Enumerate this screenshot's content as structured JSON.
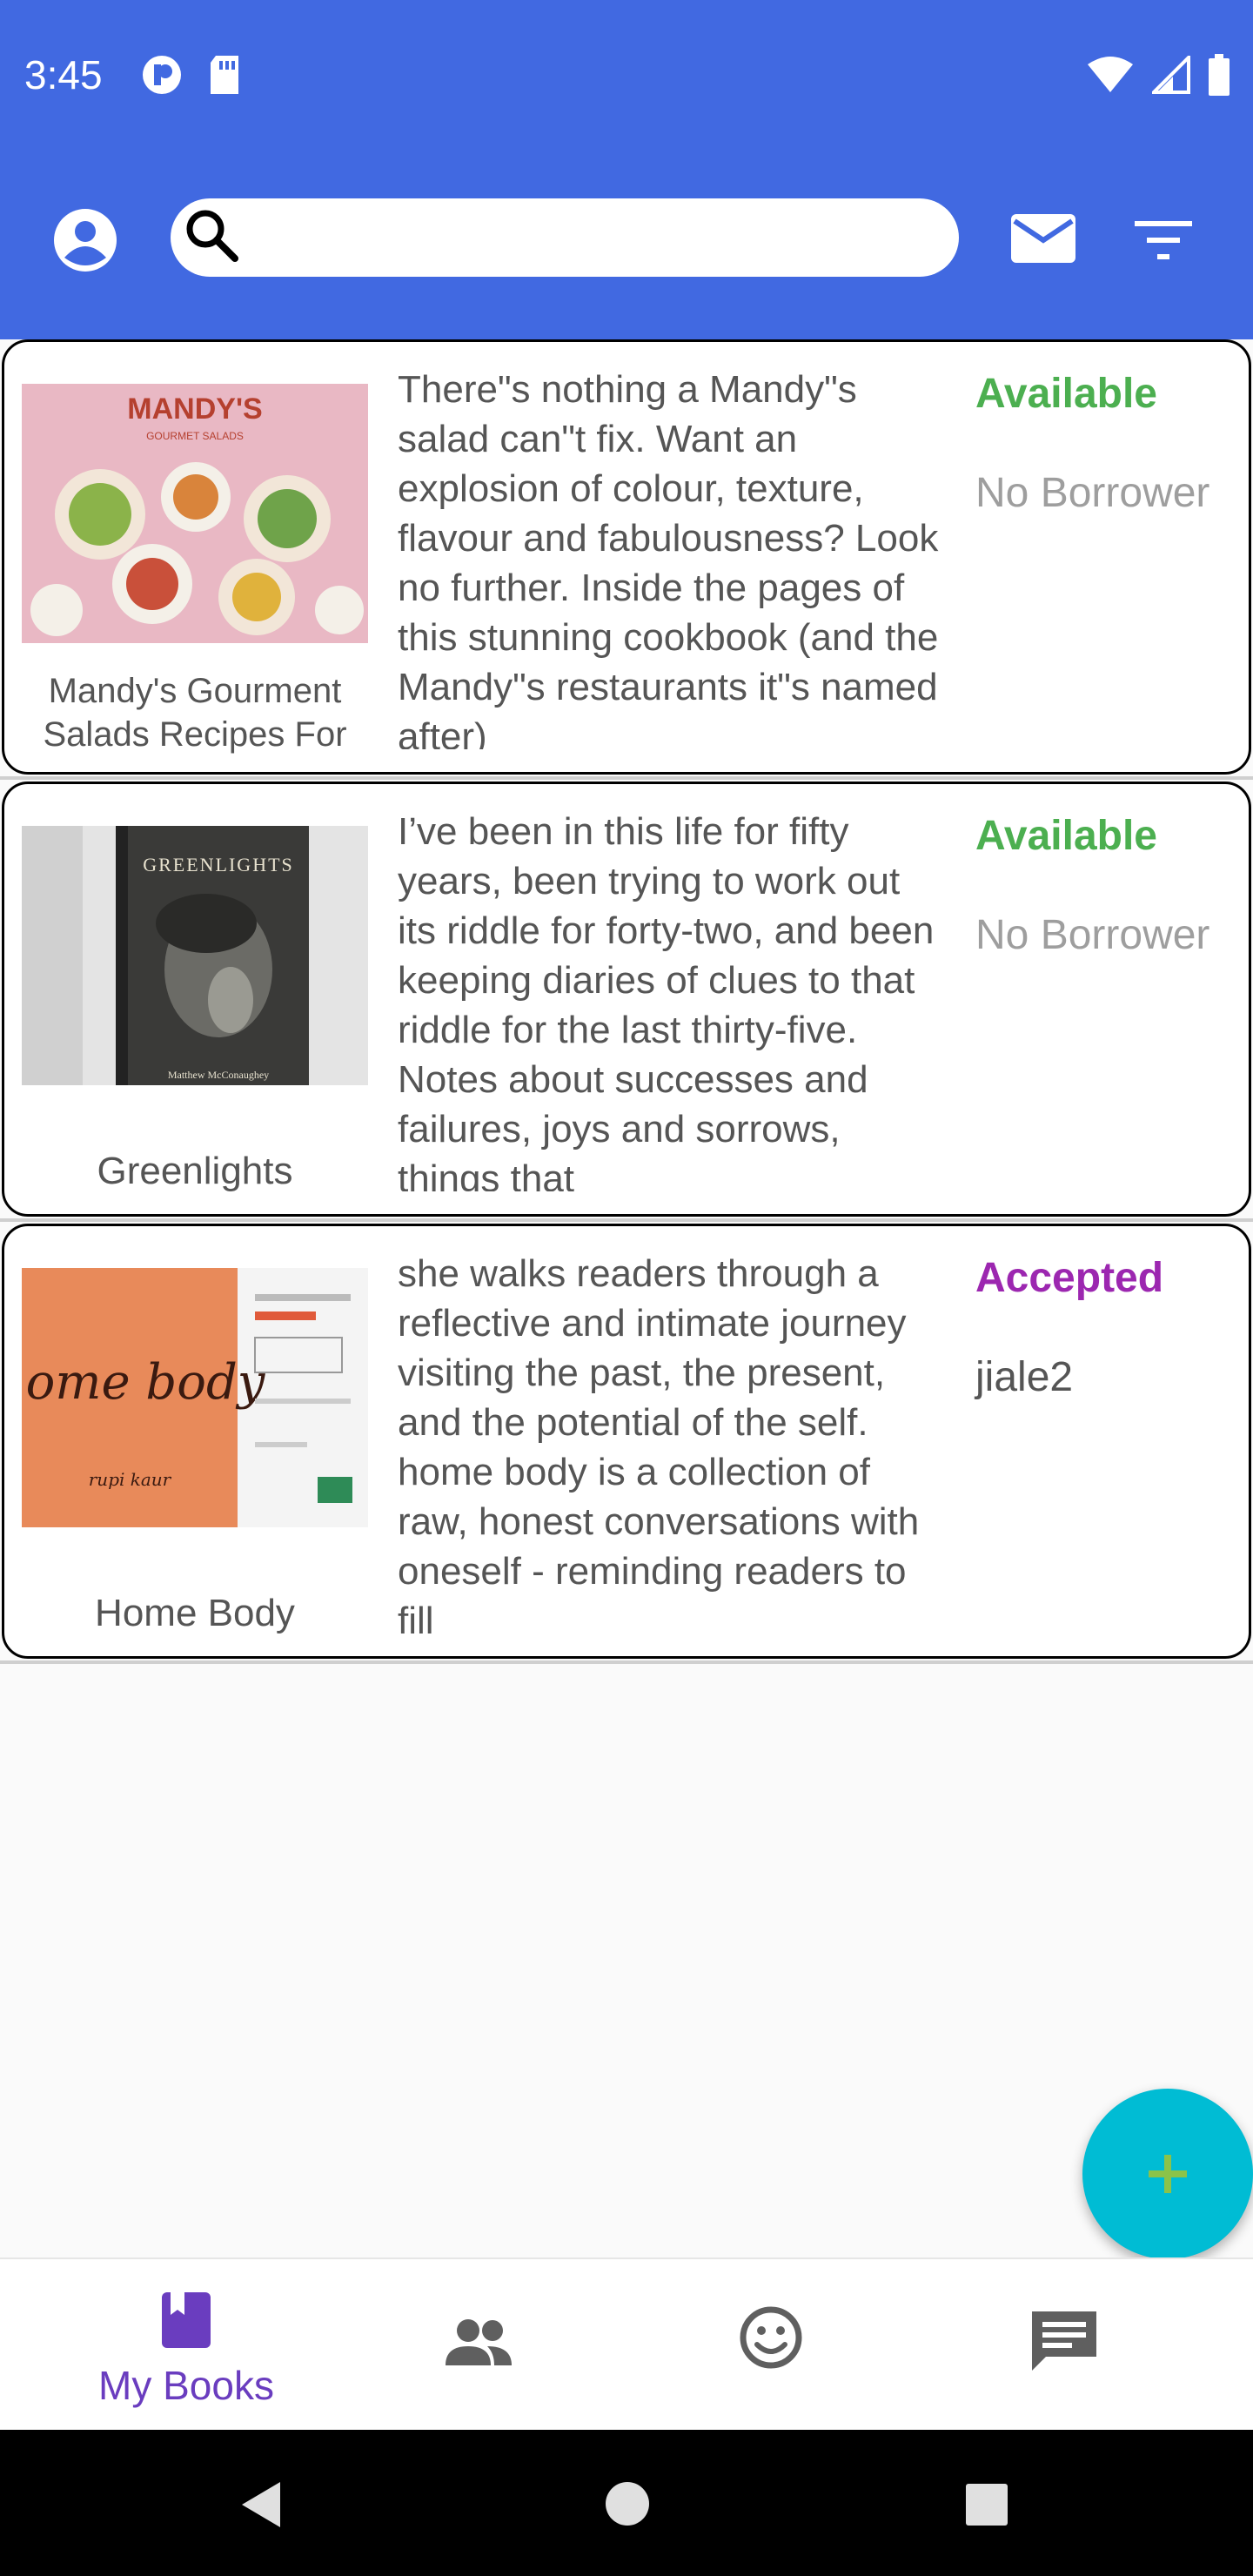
{
  "status_bar": {
    "time": "3:45",
    "icons": [
      "app-notification-icon",
      "sd-card-icon",
      "wifi-icon",
      "signal-icon",
      "battery-icon"
    ]
  },
  "app_bar": {
    "search": {
      "value": "",
      "placeholder": ""
    },
    "icons": [
      "account-circle-icon",
      "search-icon",
      "mail-icon",
      "filter-icon"
    ]
  },
  "books": [
    {
      "title": "Mandy's Gourment Salads Recipes For",
      "cover_text": "MANDY'S",
      "cover_subtext": "GOURMET SALADS",
      "description": "There\"s nothing a Mandy\"s salad can\"t fix. Want an explosion of colour, texture, flavour and fabulousness? Look no further. Inside the pages of this stunning cookbook (and the Mandy\"s restaurants it\"s named after)",
      "status": "Available",
      "status_color": "#4caf50",
      "borrower": "No Borrower"
    },
    {
      "title": "Greenlights",
      "cover_text": "GREENLIGHTS",
      "cover_subtext": "Matthew McConaughey",
      "description": "I’ve been in this life for fifty years, been trying to work out its riddle for forty-two, and been keeping diaries of clues to that riddle for the last thirty-five. Notes about successes and failures, joys and sorrows, things that",
      "status": "Available",
      "status_color": "#4caf50",
      "borrower": "No Borrower"
    },
    {
      "title": "Home Body",
      "cover_text": "home body",
      "cover_subtext": "rupi kaur",
      "description": "she walks readers through a reflective and intimate journey visiting the past, the present, and the potential of the self. home body is a collection of raw, honest conversations with oneself - reminding readers to fill",
      "status": "Accepted",
      "status_color": "#9c27b0",
      "borrower": "jiale2"
    }
  ],
  "fab": {
    "icon": "plus-icon",
    "icon_color": "#8bc34a",
    "color": "#00bcd4"
  },
  "bottom_nav": [
    {
      "label": "My Books",
      "icon": "book-icon",
      "active": true
    },
    {
      "label": "",
      "icon": "people-icon",
      "active": false
    },
    {
      "label": "",
      "icon": "smiley-icon",
      "active": false
    },
    {
      "label": "",
      "icon": "chat-icon",
      "active": false
    }
  ],
  "system_nav": [
    "back-icon",
    "home-icon",
    "recents-icon"
  ],
  "colors": {
    "primary": "#4169e1",
    "accent_active": "#6a3dbf"
  }
}
